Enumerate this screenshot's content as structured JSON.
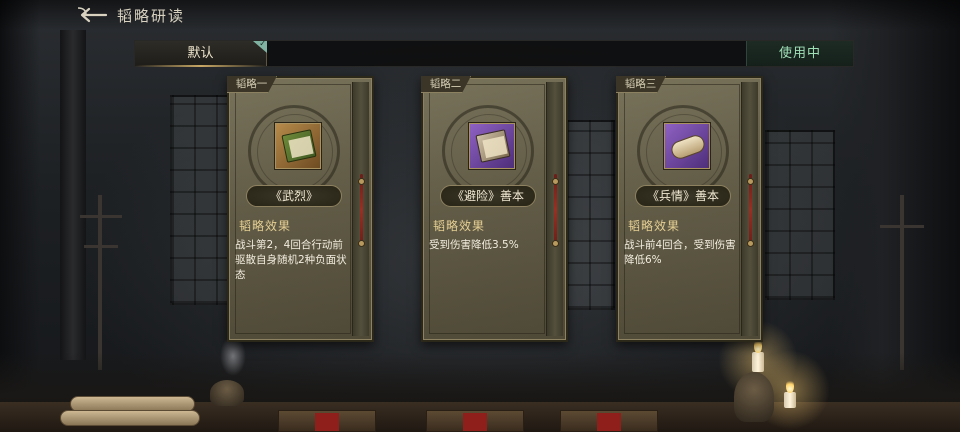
{
  "header": {
    "title": "韬略研读",
    "back_icon": "back-arrow-icon"
  },
  "preset_bar": {
    "active_tab": "默认",
    "status": "使用中",
    "accent": "#9fe0b7"
  },
  "cards": [
    {
      "tab": "韬略一",
      "name": "《武烈》",
      "effect_title": "韬略效果",
      "effect_desc": "战斗第2，4回合行动前驱散自身随机2种负面状态",
      "icon": "green-book-icon"
    },
    {
      "tab": "韬略二",
      "name": "《避险》善本",
      "effect_title": "韬略效果",
      "effect_desc": "受到伤害降低3.5%",
      "icon": "purple-book-icon"
    },
    {
      "tab": "韬略三",
      "name": "《兵情》善本",
      "effect_title": "韬略效果",
      "effect_desc": "战斗前4回合，受到伤害降低6%",
      "icon": "purple-scroll-icon"
    }
  ]
}
